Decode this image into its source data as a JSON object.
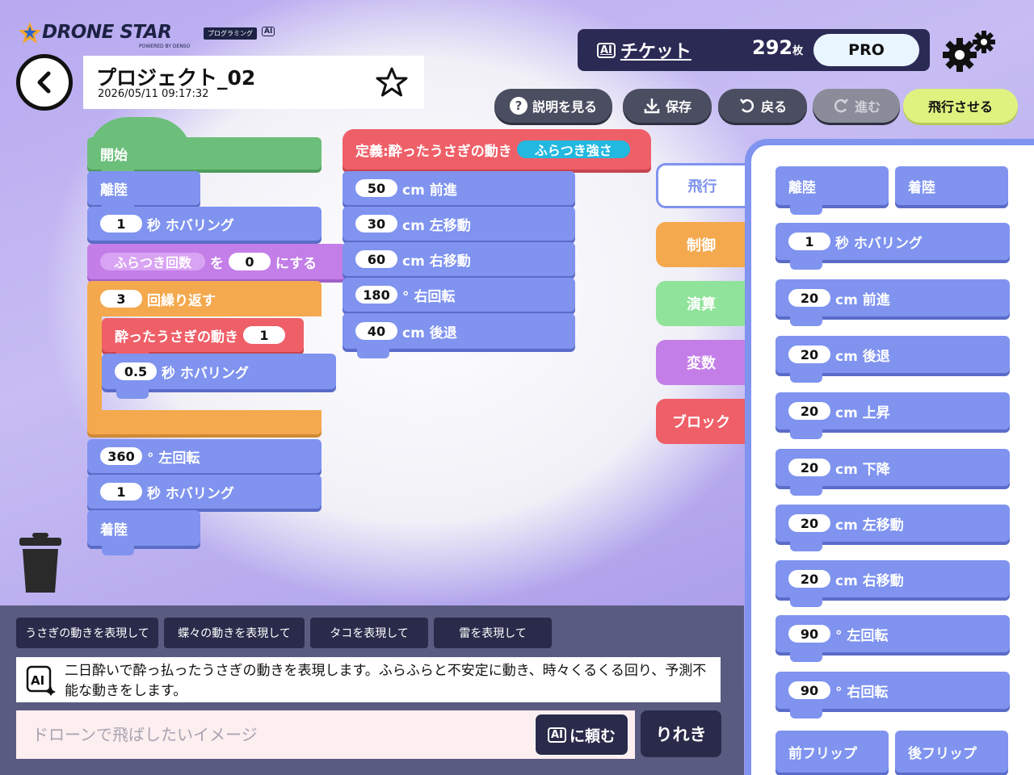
{
  "app": {
    "logo_text": "DRONE STAR",
    "logo_badge": "プログラミング",
    "logo_ai": "AI",
    "logo_sub": "POWERED BY DENSO"
  },
  "project": {
    "name": "プロジェクト_02",
    "datetime": "2026/05/11 09:17:32"
  },
  "ticket": {
    "label": "チケット",
    "count": "292",
    "unit": "枚",
    "plan": "PRO"
  },
  "toolbar": {
    "help": "説明を見る",
    "save": "保存",
    "undo": "戻る",
    "redo": "進む",
    "fly": "飛行させる"
  },
  "workspace": {
    "start": "開始",
    "takeoff": "離陸",
    "hover1_value": "1",
    "hover_label": "秒 ホバリング",
    "set_var_name": "ふらつき回数",
    "set_var_to": "を",
    "set_var_value": "0",
    "set_var_suffix": "にする",
    "repeat_value": "3",
    "repeat_label": "回繰り返す",
    "call_name": "酔ったうさぎの動き",
    "call_value": "1",
    "hover_inner_value": "0.5",
    "turn_left_value": "360",
    "turn_left_label": "° 左回転",
    "hover2_value": "1",
    "land": "着陸",
    "define_label": "定義:酔ったうさぎの動き",
    "define_param": "ふらつき強さ",
    "forward_value": "50",
    "forward_label": "cm 前進",
    "left_value": "30",
    "left_label": "cm 左移動",
    "right_value": "60",
    "right_label": "cm 右移動",
    "turn_right_value": "180",
    "turn_right_label": "° 右回転",
    "back_value": "40",
    "back_label": "cm 後退"
  },
  "categories": [
    "飛行",
    "制御",
    "演算",
    "変数",
    "ブロック"
  ],
  "category_colors": [
    "#7f93ef",
    "#f4a94e",
    "#8fe39a",
    "#c37ee8",
    "#ef5f68"
  ],
  "palette": {
    "takeoff": "離陸",
    "land": "着陸",
    "items": [
      {
        "value": "1",
        "label": "秒 ホバリング"
      },
      {
        "value": "20",
        "label": "cm 前進"
      },
      {
        "value": "20",
        "label": "cm 後退"
      },
      {
        "value": "20",
        "label": "cm 上昇"
      },
      {
        "value": "20",
        "label": "cm 下降"
      },
      {
        "value": "20",
        "label": "cm 左移動"
      },
      {
        "value": "20",
        "label": "cm 右移動"
      },
      {
        "value": "90",
        "label": "° 左回転"
      },
      {
        "value": "90",
        "label": "° 右回転"
      }
    ],
    "flip_front": "前フリップ",
    "flip_back": "後フリップ"
  },
  "ai": {
    "suggestions": [
      "うさぎの動きを表現して",
      "蝶々の動きを表現して",
      "タコを表現して",
      "雷を表現して"
    ],
    "message": "二日酔いで酔っ払ったうさぎの動きを表現します。ふらふらと不安定に動き、時々くるくる回り、予測不能な動きをします。",
    "input_placeholder": "ドローンで飛ばしたいイメージ",
    "ask_label": "に頼む",
    "ask_icon": "AI",
    "user_name": "りれき"
  }
}
